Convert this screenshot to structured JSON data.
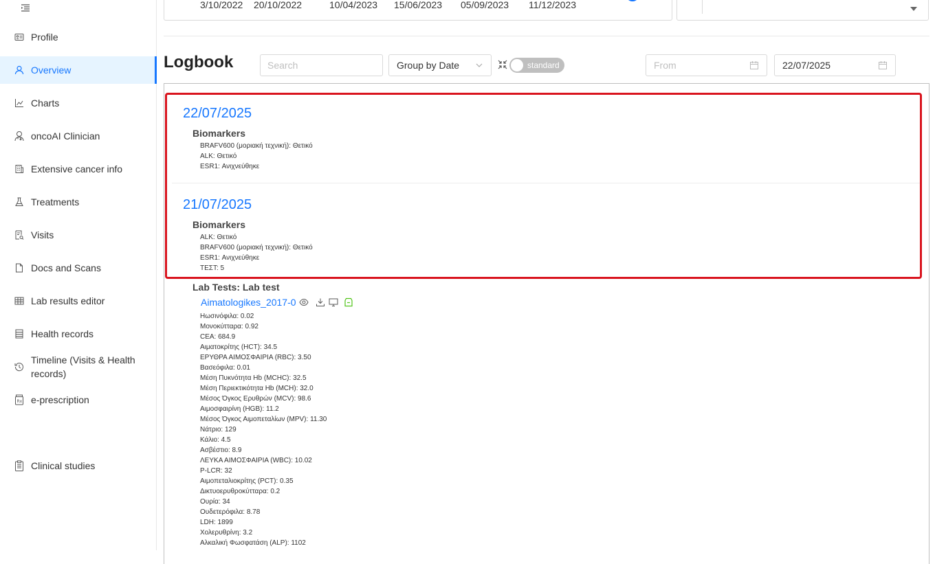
{
  "sidebar": {
    "items": [
      {
        "label": "Profile",
        "icon": "profile-card-icon"
      },
      {
        "label": "Overview",
        "icon": "user-icon",
        "active": true
      },
      {
        "label": "Charts",
        "icon": "chart-icon"
      },
      {
        "label": "oncoAI Clinician",
        "icon": "doctor-icon"
      },
      {
        "label": "Extensive cancer info",
        "icon": "building-icon"
      },
      {
        "label": "Treatments",
        "icon": "flask-icon"
      },
      {
        "label": "Visits",
        "icon": "visit-document-icon"
      },
      {
        "label": "Docs and Scans",
        "icon": "file-icon"
      },
      {
        "label": "Lab results editor",
        "icon": "table-icon"
      },
      {
        "label": "Health records",
        "icon": "records-icon"
      },
      {
        "label": "Timeline (Visits & Health records)",
        "icon": "history-icon"
      },
      {
        "label": "e-prescription",
        "icon": "prescription-icon"
      },
      {
        "label": "Clinical studies",
        "icon": "clipboard-icon"
      }
    ]
  },
  "top": {
    "dates": [
      "3/10/2022",
      "20/10/2022",
      "10/04/2023",
      "15/06/2023",
      "05/09/2023",
      "11/12/2023"
    ]
  },
  "logbook": {
    "title": "Logbook",
    "search_placeholder": "Search",
    "group_by": "Group by Date",
    "toggle_label": "standard",
    "from_placeholder": "From",
    "to_value": "22/07/2025"
  },
  "entries": [
    {
      "date": "22/07/2025",
      "section": "Biomarkers",
      "lines": [
        "BRAFV600 (μοριακή τεχνική): Θετικό",
        "ALK: Θετικό",
        "ESR1: Ανιχνεύθηκε"
      ]
    },
    {
      "date": "21/07/2025",
      "section": "Biomarkers",
      "lines": [
        "ALK: Θετικό",
        "BRAFV600 (μοριακή τεχνική): Θετικό",
        "ESR1: Ανιχνεύθηκε",
        "TEΣT: 5"
      ]
    }
  ],
  "lab": {
    "section": "Lab Tests: Lab test",
    "file": "Aimatologikes_2017-0",
    "lines": [
      "Ηωσινόφιλα: 0.02",
      "Μονοκύτταρα: 0.92",
      "CEA: 684.9",
      "Αιματοκρίτης (HCT): 34.5",
      "ΕΡΥΘΡΑ ΑΙΜΟΣΦΑΙΡΙΑ (RBC): 3.50",
      "Βασεόφιλα: 0.01",
      "Μέση Πυκνότητα Hb (MCHC): 32.5",
      "Μέση Περιεκτικότητα Hb (MCH): 32.0",
      "Μέσος Όγκος Ερυθρών (MCV): 98.6",
      "Αιμοσφαιρίνη (HGB): 11.2",
      "Μέσος Όγκος Αιμοπεταλίων (MPV): 11.30",
      "Νάτριο: 129",
      "Κάλιο: 4.5",
      "Ασβέστιο: 8.9",
      "ΛΕΥΚΑ ΑΙΜΟΣΦΑΙΡΙΑ (WBC): 10.02",
      "P-LCR: 32",
      "Αιμοπεταλιοκρίτης (PCT): 0.35",
      "Δικτυοερυθροκύτταρα: 0.2",
      "Ουρία: 34",
      "Ουδετερόφιλα: 8.78",
      "LDH: 1899",
      "Χολερυθρίνη: 3.2",
      "Αλκαλική Φωσφατάση (ALP): 1102"
    ]
  },
  "colors": {
    "accent": "#1677ff",
    "highlight": "#d9141e",
    "archive_icon": "#52c41a"
  }
}
